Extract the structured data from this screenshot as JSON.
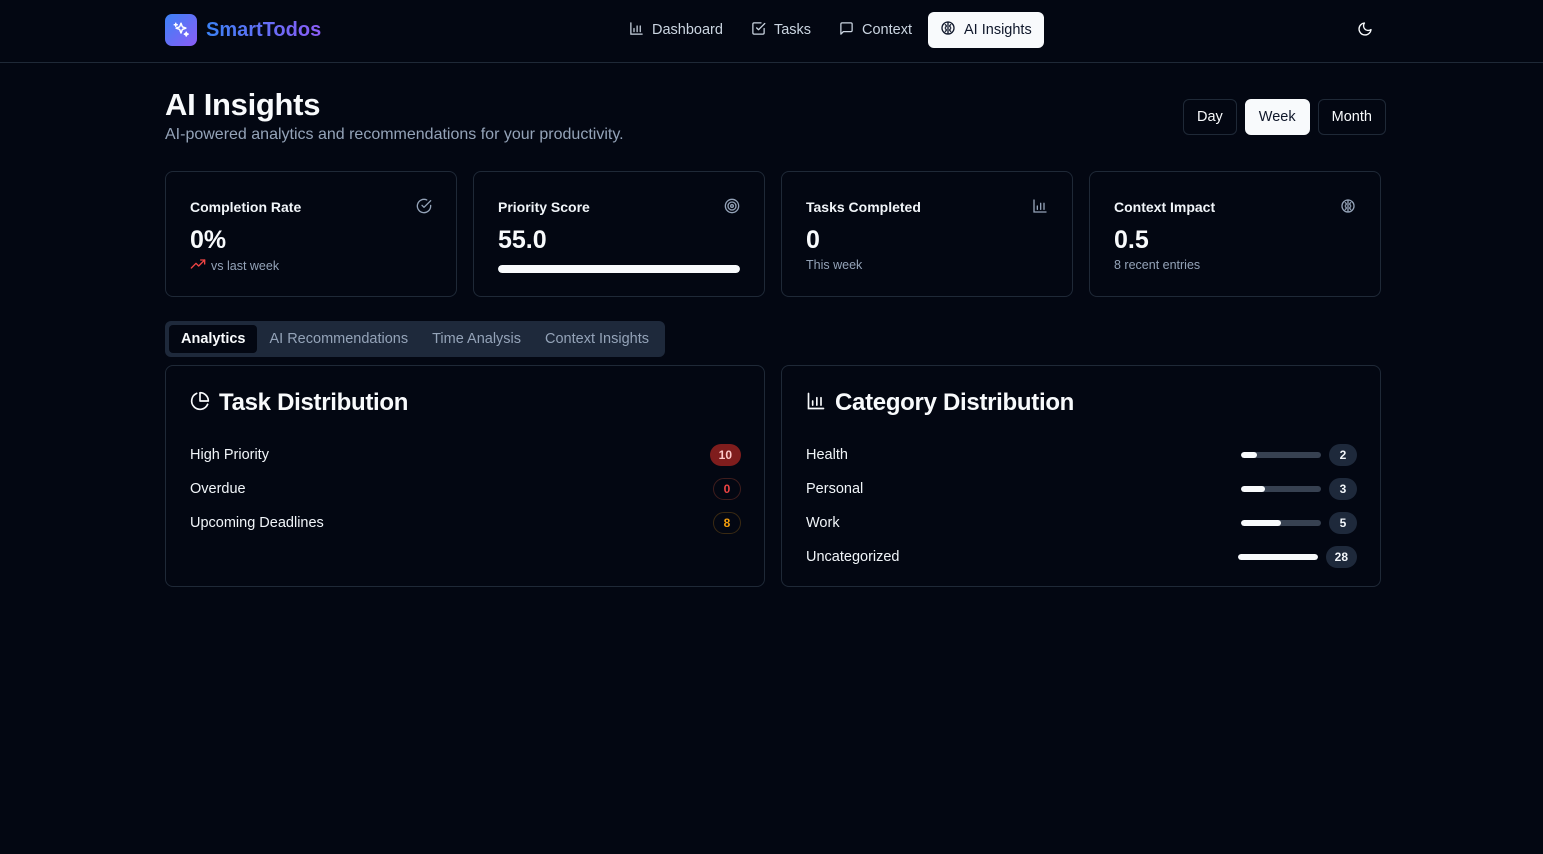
{
  "brand": {
    "name": "SmartTodos",
    "icon": "sparkles-icon"
  },
  "nav": [
    {
      "label": "Dashboard",
      "icon": "bar-chart-icon",
      "active": false
    },
    {
      "label": "Tasks",
      "icon": "check-square-icon",
      "active": false
    },
    {
      "label": "Context",
      "icon": "message-square-icon",
      "active": false
    },
    {
      "label": "AI Insights",
      "icon": "brain-icon",
      "active": true
    }
  ],
  "theme_toggle": {
    "icon": "moon-icon"
  },
  "page": {
    "title": "AI Insights",
    "subtitle": "AI-powered analytics and recommendations for your productivity."
  },
  "period": {
    "options": [
      "Day",
      "Week",
      "Month"
    ],
    "selected": "Week"
  },
  "stats": [
    {
      "title": "Completion Rate",
      "value": "0%",
      "sub": "vs last week",
      "icon": "check-circle-icon",
      "sub_icon": "trending-down-icon"
    },
    {
      "title": "Priority Score",
      "value": "55.0",
      "icon": "target-icon",
      "progress": 1.0
    },
    {
      "title": "Tasks Completed",
      "value": "0",
      "sub": "This week",
      "icon": "bar-chart-icon"
    },
    {
      "title": "Context Impact",
      "value": "0.5",
      "sub": "8 recent entries",
      "icon": "brain-icon"
    }
  ],
  "tabs": [
    {
      "label": "Analytics",
      "active": true
    },
    {
      "label": "AI Recommendations",
      "active": false
    },
    {
      "label": "Time Analysis",
      "active": false
    },
    {
      "label": "Context Insights",
      "active": false
    }
  ],
  "task_distribution": {
    "title": "Task Distribution",
    "icon": "pie-chart-icon",
    "rows": [
      {
        "label": "High Priority",
        "count": "10",
        "variant": "high"
      },
      {
        "label": "Overdue",
        "count": "0",
        "variant": "overdue"
      },
      {
        "label": "Upcoming Deadlines",
        "count": "8",
        "variant": "upcoming"
      }
    ]
  },
  "category_distribution": {
    "title": "Category Distribution",
    "icon": "bar-chart-icon",
    "rows": [
      {
        "label": "Health",
        "count": "2",
        "fraction": 0.2
      },
      {
        "label": "Personal",
        "count": "3",
        "fraction": 0.3
      },
      {
        "label": "Work",
        "count": "5",
        "fraction": 0.5
      },
      {
        "label": "Uncategorized",
        "count": "28",
        "fraction": 1.0
      }
    ]
  },
  "colors": {
    "background": "#030712",
    "accent_gradient_start": "#3b82f6",
    "accent_gradient_end": "#8b5cf6",
    "high_priority": "#7f1d1d",
    "overdue": "#ef4444",
    "upcoming": "#f59e0b",
    "trend_down": "#ef4444"
  }
}
